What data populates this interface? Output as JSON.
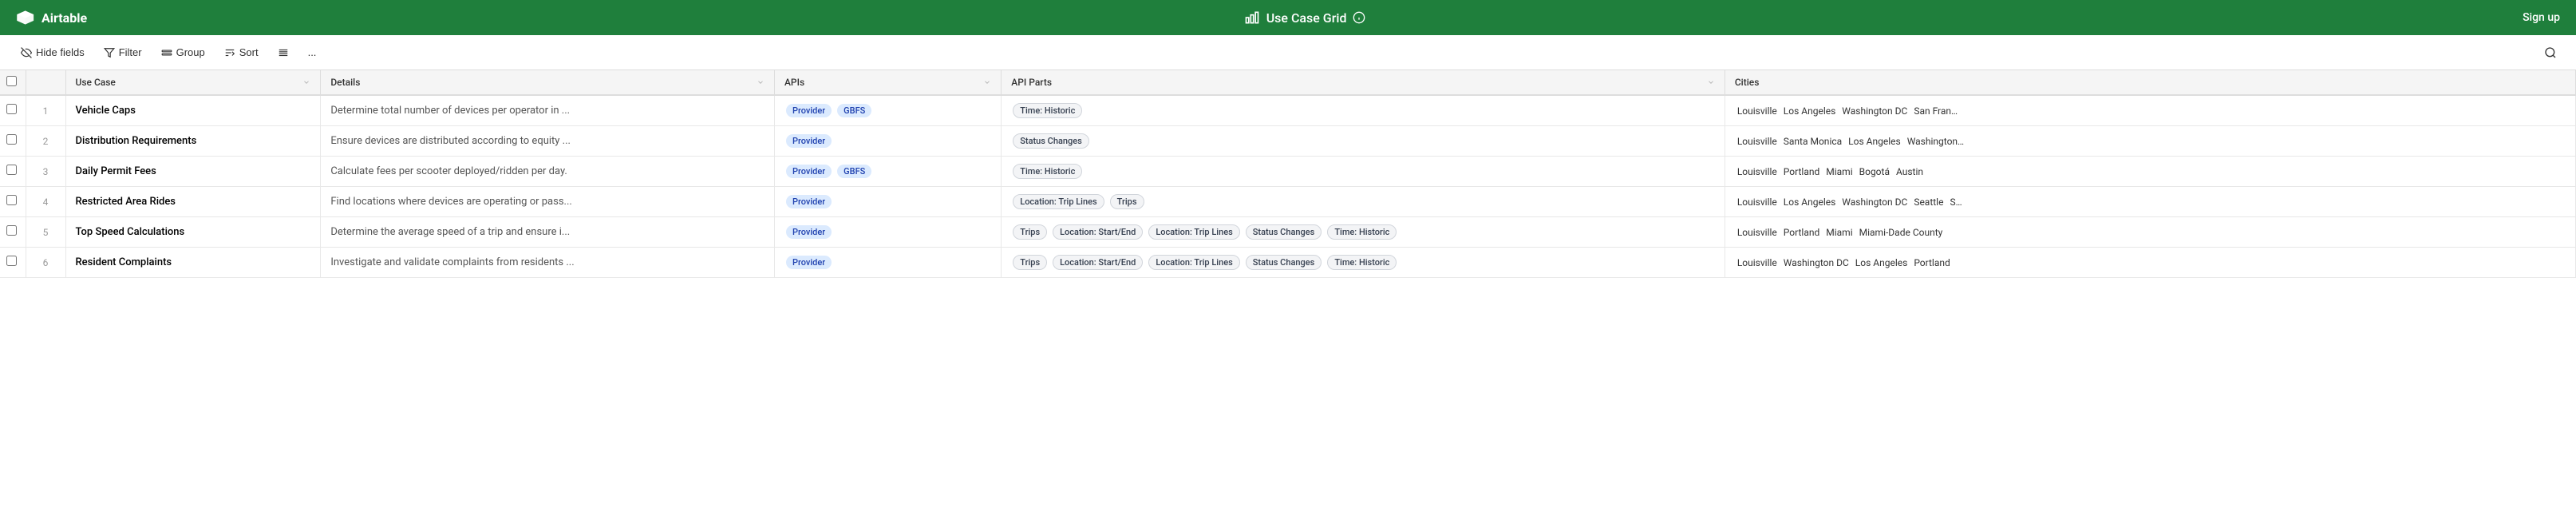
{
  "app": {
    "logo": "Airtable",
    "title": "Use Case Grid",
    "signup": "Sign up"
  },
  "toolbar": {
    "hide_fields": "Hide fields",
    "filter": "Filter",
    "group": "Group",
    "sort": "Sort",
    "options_icon": "≡",
    "more": "..."
  },
  "table": {
    "columns": [
      {
        "id": "use-case",
        "label": "Use Case",
        "has_sort": true
      },
      {
        "id": "details",
        "label": "Details",
        "has_sort": true
      },
      {
        "id": "apis",
        "label": "APIs",
        "has_sort": true
      },
      {
        "id": "api-parts",
        "label": "API Parts",
        "has_sort": true
      },
      {
        "id": "cities",
        "label": "Cities",
        "has_sort": false
      }
    ],
    "rows": [
      {
        "num": "1",
        "use_case": "Vehicle Caps",
        "details": "Determine total number of devices per operator in ...",
        "apis": [
          "Provider",
          "GBFS"
        ],
        "api_parts": [
          "Time: Historic"
        ],
        "cities": [
          "Louisville",
          "Los Angeles",
          "Washington DC",
          "San Fran…"
        ]
      },
      {
        "num": "2",
        "use_case": "Distribution Requirements",
        "details": "Ensure devices are distributed according to equity ...",
        "apis": [
          "Provider"
        ],
        "api_parts": [
          "Status Changes"
        ],
        "cities": [
          "Louisville",
          "Santa Monica",
          "Los Angeles",
          "Washington…"
        ]
      },
      {
        "num": "3",
        "use_case": "Daily Permit Fees",
        "details": "Calculate fees per scooter deployed/ridden per day.",
        "apis": [
          "Provider",
          "GBFS"
        ],
        "api_parts": [
          "Time: Historic"
        ],
        "cities": [
          "Louisville",
          "Portland",
          "Miami",
          "Bogotá",
          "Austin"
        ]
      },
      {
        "num": "4",
        "use_case": "Restricted Area Rides",
        "details": "Find locations where devices are operating or pass...",
        "apis": [
          "Provider"
        ],
        "api_parts": [
          "Location: Trip Lines",
          "Trips"
        ],
        "cities": [
          "Louisville",
          "Los Angeles",
          "Washington DC",
          "Seattle",
          "S…"
        ]
      },
      {
        "num": "5",
        "use_case": "Top Speed Calculations",
        "details": "Determine the average speed of a trip and ensure i...",
        "apis": [
          "Provider"
        ],
        "api_parts": [
          "Trips",
          "Location: Start/End",
          "Location: Trip Lines",
          "Status Changes",
          "Time: Historic"
        ],
        "cities": [
          "Louisville",
          "Portland",
          "Miami",
          "Miami-Dade County"
        ]
      },
      {
        "num": "6",
        "use_case": "Resident Complaints",
        "details": "Investigate and validate complaints from residents ...",
        "apis": [
          "Provider"
        ],
        "api_parts": [
          "Trips",
          "Location: Start/End",
          "Location: Trip Lines",
          "Status Changes",
          "Time: Historic"
        ],
        "cities": [
          "Louisville",
          "Washington DC",
          "Los Angeles",
          "Portland"
        ]
      }
    ]
  }
}
